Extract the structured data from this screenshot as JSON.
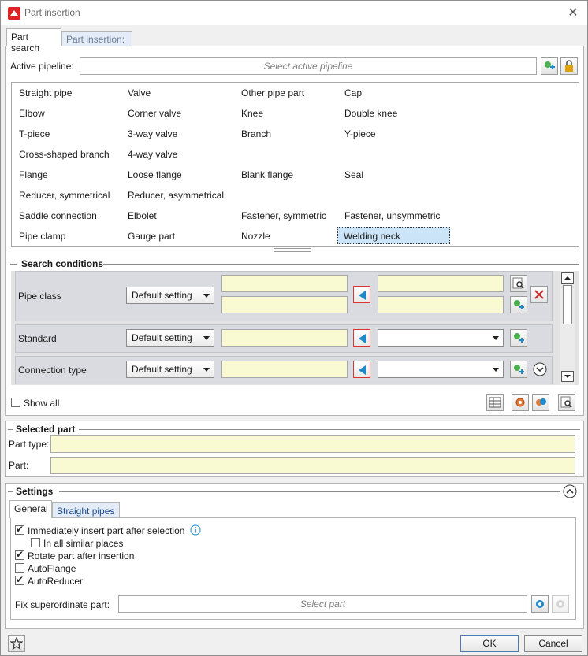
{
  "window": {
    "title": "Part insertion",
    "close_glyph": "✕"
  },
  "tabs": [
    {
      "label": "Part search"
    },
    {
      "label": "Part insertion:"
    }
  ],
  "active_pipeline": {
    "label": "Active pipeline:",
    "placeholder": "Select active pipeline"
  },
  "part_types": [
    [
      "Straight pipe",
      "Valve",
      "Other pipe part",
      "Cap"
    ],
    [
      "Elbow",
      "Corner valve",
      "Knee",
      "Double knee"
    ],
    [
      "T-piece",
      "3-way valve",
      "Branch",
      "Y-piece"
    ],
    [
      "Cross-shaped branch",
      "4-way valve",
      "",
      ""
    ],
    [
      "Flange",
      "Loose flange",
      "Blank flange",
      "Seal"
    ],
    [
      "Reducer, symmetrical",
      "Reducer, asymmetrical",
      "",
      ""
    ],
    [
      "Saddle connection",
      "Elbolet",
      "Fastener, symmetric",
      "Fastener, unsymmetric"
    ],
    [
      "Pipe clamp",
      "Gauge part",
      "Nozzle",
      "Welding neck"
    ]
  ],
  "selected_part_type": "Welding neck",
  "search_conditions": {
    "header": "Search conditions",
    "rows": [
      {
        "label": "Pipe class",
        "setting": "Default setting"
      },
      {
        "label": "Standard",
        "setting": "Default setting"
      },
      {
        "label": "Connection type",
        "setting": "Default setting"
      }
    ],
    "show_all": {
      "label": "Show all",
      "checked": false
    }
  },
  "selected_part": {
    "header": "Selected part",
    "part_type_label": "Part type:",
    "part_label": "Part:"
  },
  "settings": {
    "header": "Settings",
    "tabs": [
      {
        "label": "General"
      },
      {
        "label": "Straight pipes"
      }
    ],
    "options": [
      {
        "label": "Immediately insert part after selection",
        "checked": true
      },
      {
        "label": "In all similar places",
        "checked": false
      },
      {
        "label": "Rotate part after insertion",
        "checked": true
      },
      {
        "label": "AutoFlange",
        "checked": false
      },
      {
        "label": "AutoReducer",
        "checked": true
      }
    ],
    "fix_superordinate": {
      "label": "Fix superordinate part:",
      "placeholder": "Select part"
    }
  },
  "footer": {
    "ok": "OK",
    "cancel": "Cancel"
  },
  "colors": {
    "accent": "#1e88c8",
    "field_yellow": "#fafad2",
    "selection": "#cce4f7"
  }
}
